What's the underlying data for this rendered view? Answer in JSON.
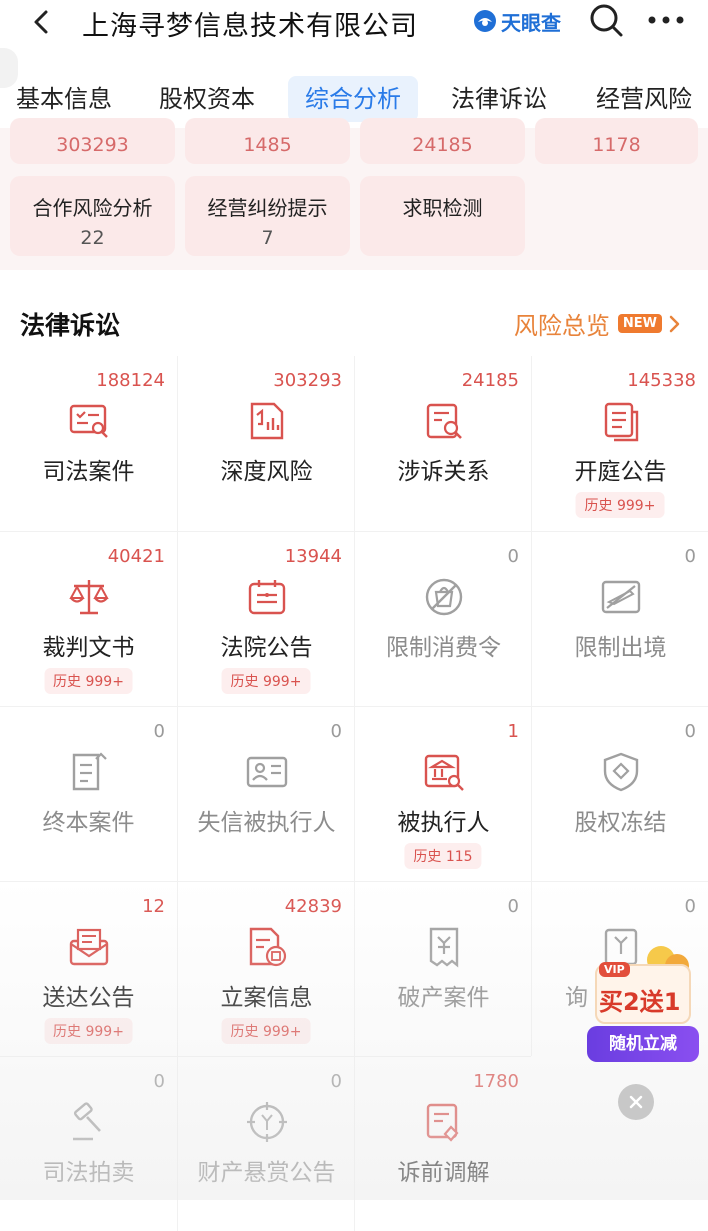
{
  "header": {
    "title": "上海寻梦信息技术有限公司",
    "brand": "天眼查"
  },
  "tabs": [
    {
      "label": "基本信息",
      "active": false
    },
    {
      "label": "股权资本",
      "active": false
    },
    {
      "label": "综合分析",
      "active": true
    },
    {
      "label": "法律诉讼",
      "active": false
    },
    {
      "label": "经营风险",
      "active": false
    }
  ],
  "summary": {
    "top_numbers": [
      "303293",
      "1485",
      "24185",
      "1178"
    ],
    "cards": [
      {
        "label": "合作风险分析",
        "count": "22"
      },
      {
        "label": "经营纠纷提示",
        "count": "7"
      },
      {
        "label": "求职检测",
        "count": ""
      }
    ]
  },
  "section": {
    "title": "法律诉讼",
    "link": "风险总览",
    "badge": "NEW",
    "items": [
      {
        "label": "司法案件",
        "count": "188124",
        "history": "",
        "active": true
      },
      {
        "label": "深度风险",
        "count": "303293",
        "history": "",
        "active": true
      },
      {
        "label": "涉诉关系",
        "count": "24185",
        "history": "",
        "active": true
      },
      {
        "label": "开庭公告",
        "count": "145338",
        "history": "历史 999+",
        "active": true
      },
      {
        "label": "裁判文书",
        "count": "40421",
        "history": "历史 999+",
        "active": true
      },
      {
        "label": "法院公告",
        "count": "13944",
        "history": "历史 999+",
        "active": true
      },
      {
        "label": "限制消费令",
        "count": "0",
        "history": "",
        "active": false
      },
      {
        "label": "限制出境",
        "count": "0",
        "history": "",
        "active": false
      },
      {
        "label": "终本案件",
        "count": "0",
        "history": "",
        "active": false
      },
      {
        "label": "失信被执行人",
        "count": "0",
        "history": "",
        "active": false
      },
      {
        "label": "被执行人",
        "count": "1",
        "history": "历史 115",
        "active": true
      },
      {
        "label": "股权冻结",
        "count": "0",
        "history": "",
        "active": false
      },
      {
        "label": "送达公告",
        "count": "12",
        "history": "历史 999+",
        "active": true
      },
      {
        "label": "立案信息",
        "count": "42839",
        "history": "历史 999+",
        "active": true
      },
      {
        "label": "破产案件",
        "count": "0",
        "history": "",
        "active": false
      },
      {
        "label": "询",
        "count": "0",
        "history": "",
        "active": false
      },
      {
        "label": "司法拍卖",
        "count": "0",
        "history": "",
        "active": false
      },
      {
        "label": "财产悬赏公告",
        "count": "0",
        "history": "",
        "active": false
      },
      {
        "label": "诉前调解",
        "count": "1780",
        "history": "",
        "active": true
      }
    ]
  },
  "promo": {
    "vip": "VIP",
    "main": "买2送1",
    "button": "随机立减"
  },
  "colors": {
    "accent_blue": "#2a7be8",
    "risk_red": "#d9534f",
    "link_orange": "#e8833a"
  }
}
